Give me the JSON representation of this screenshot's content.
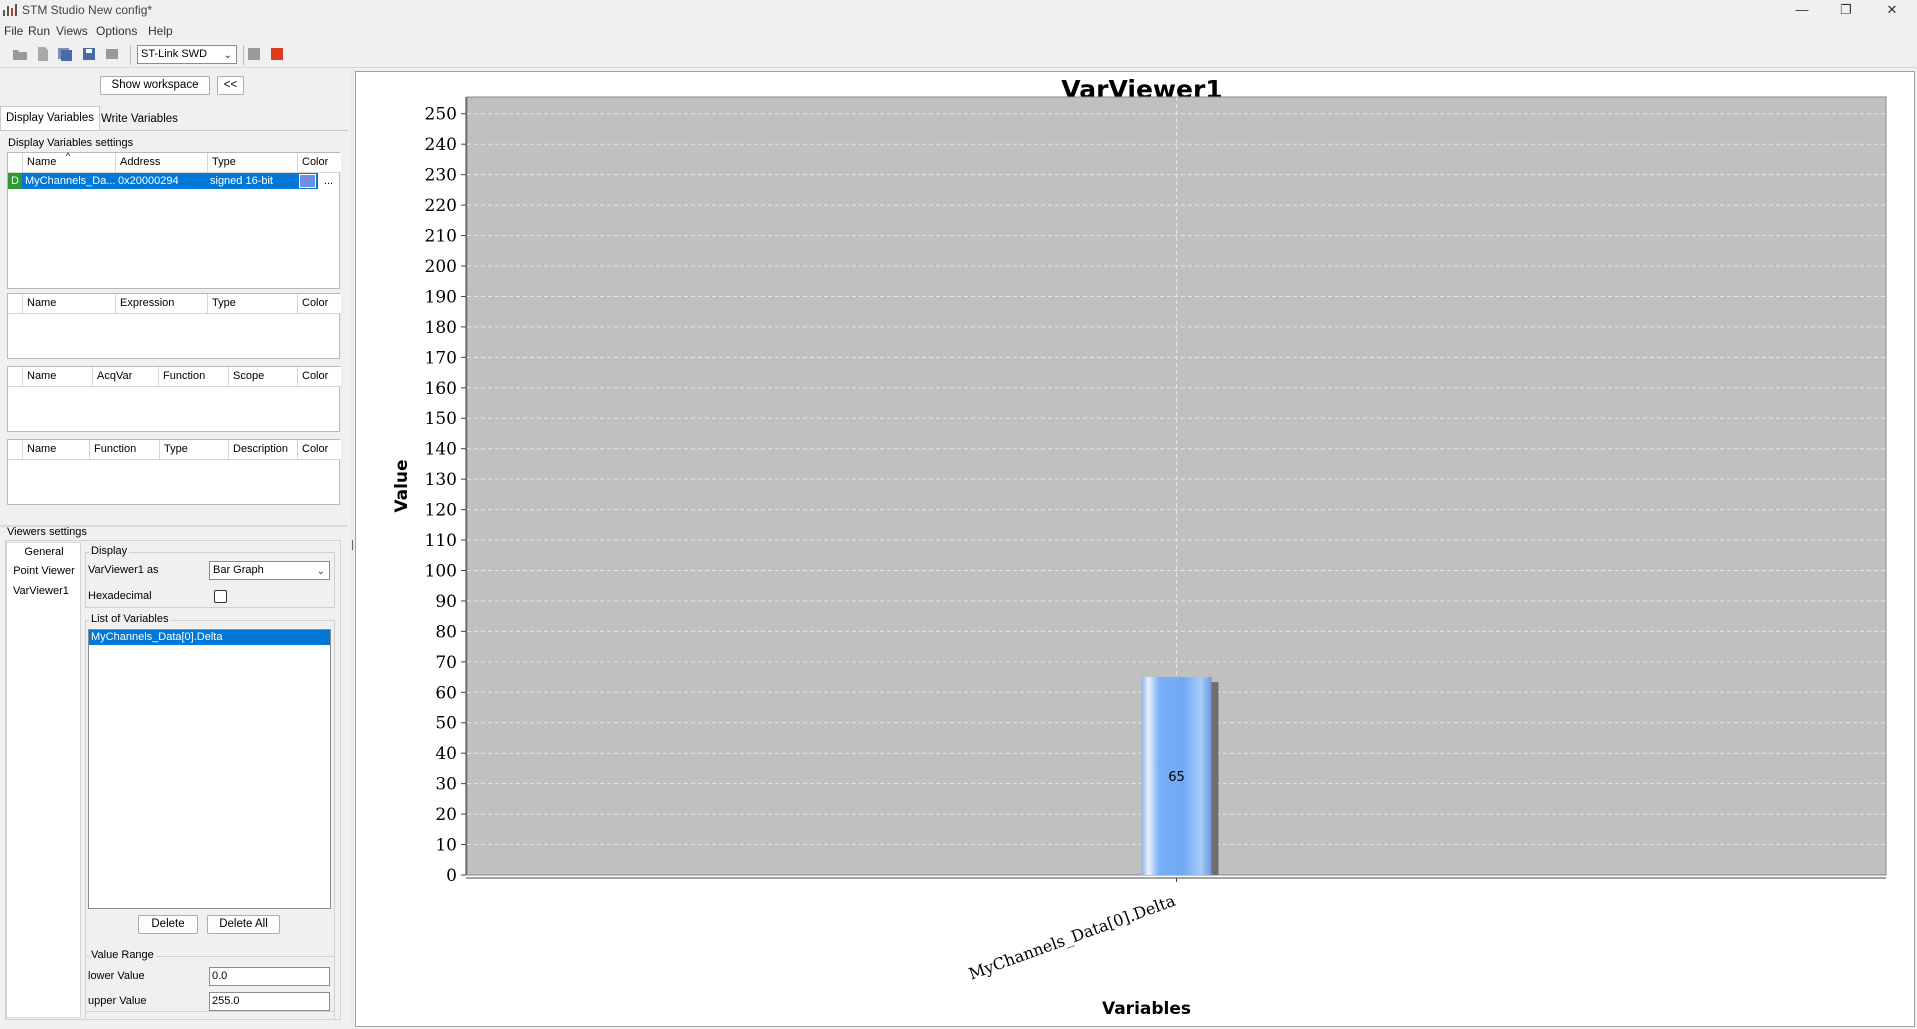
{
  "window": {
    "title": "STM Studio New config*",
    "minimize_icon": "minimize-icon",
    "maximize_icon": "restore-icon",
    "close_icon": "close-icon"
  },
  "menu": [
    "File",
    "Run",
    "Views",
    "Options",
    "Help"
  ],
  "toolbar": {
    "connection": "ST-Link SWD",
    "icons": [
      "open-folder-icon",
      "new-file-icon",
      "save-all-icon",
      "save-icon",
      "import-icon",
      "stop-icon",
      "record-icon"
    ]
  },
  "workspace": {
    "show_workspace_label": "Show workspace",
    "collapse_label": "<<"
  },
  "tabs": [
    "Display Variables",
    "Write Variables"
  ],
  "display_settings": {
    "title": "Display Variables settings",
    "var_table": {
      "columns": [
        "Name",
        "Address",
        "Type",
        "Color"
      ],
      "rows": [
        {
          "flag": "D",
          "name": "MyChannels_Da...",
          "address": "0x20000294",
          "type": "signed 16-bit",
          "color": "#6f8fe0",
          "more": "..."
        }
      ]
    },
    "expr_table": {
      "columns": [
        "Name",
        "Expression",
        "Type",
        "Color"
      ]
    },
    "acq_table": {
      "columns": [
        "Name",
        "AcqVar",
        "Function",
        "Scope",
        "Color"
      ]
    },
    "func_table": {
      "columns": [
        "Name",
        "Function",
        "Type",
        "Description",
        "Color"
      ]
    }
  },
  "viewers": {
    "title": "Viewers settings",
    "list": [
      "General",
      "Point Viewer",
      "VarViewer1"
    ],
    "display_group": "Display",
    "viewer_as_label": "VarViewer1 as",
    "viewer_as_value": "Bar Graph",
    "hexadecimal_label": "Hexadecimal",
    "hexadecimal_checked": false,
    "list_of_variables_group": "List of Variables",
    "variables": [
      "MyChannels_Data[0].Delta"
    ],
    "delete_label": "Delete",
    "delete_all_label": "Delete All",
    "value_range_group": "Value Range",
    "lower_label": "lower Value",
    "lower_value": "0.0",
    "upper_label": "upper Value",
    "upper_value": "255.0"
  },
  "chart_data": {
    "type": "bar",
    "title": "VarViewer1",
    "xlabel": "Variables",
    "ylabel": "Value",
    "categories": [
      "MyChannels_Data[0].Delta"
    ],
    "values": [
      65
    ],
    "data_labels": [
      "65"
    ],
    "ylim": [
      0,
      255
    ],
    "yticks": [
      0,
      10,
      20,
      30,
      40,
      50,
      60,
      70,
      80,
      90,
      100,
      110,
      120,
      130,
      140,
      150,
      160,
      170,
      180,
      190,
      200,
      210,
      220,
      230,
      240,
      250
    ],
    "grid": true,
    "bar_color": "#6fa8f5",
    "plot_background": "#c0c0c0"
  }
}
